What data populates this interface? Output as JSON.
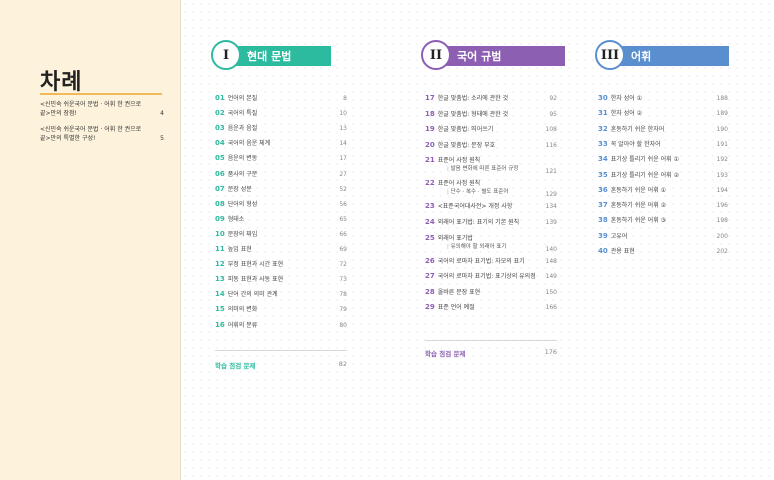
{
  "title": "차례",
  "intro": [
    {
      "text": "<신민숙 쉬운국어 문법 · 어휘 한 권으로 끝>만의 장점!",
      "page": "4"
    },
    {
      "text": "<신민숙 쉬운국어 문법 · 어휘 한 권으로 끝>만의 특별한 구성!",
      "page": "5"
    }
  ],
  "sections": [
    {
      "roman": "I",
      "title": "현대 문법",
      "color": "#2dbb9f",
      "entries": [
        {
          "num": "01",
          "title": "언어의 본질",
          "page": "8"
        },
        {
          "num": "02",
          "title": "국어의 특질",
          "page": "10"
        },
        {
          "num": "03",
          "title": "음운과 음절",
          "page": "13"
        },
        {
          "num": "04",
          "title": "국어의 음운 체계",
          "page": "14"
        },
        {
          "num": "05",
          "title": "음운의 변동",
          "page": "17"
        },
        {
          "num": "06",
          "title": "품사의 구분",
          "page": "27"
        },
        {
          "num": "07",
          "title": "문장 성분",
          "page": "52"
        },
        {
          "num": "08",
          "title": "단어의 형성",
          "page": "56"
        },
        {
          "num": "09",
          "title": "형태소",
          "page": "65"
        },
        {
          "num": "10",
          "title": "문장의 짜임",
          "page": "66"
        },
        {
          "num": "11",
          "title": "높임 표현",
          "page": "69"
        },
        {
          "num": "12",
          "title": "부정 표현과 시간 표현",
          "page": "72"
        },
        {
          "num": "13",
          "title": "피동 표현과 사동 표현",
          "page": "73"
        },
        {
          "num": "14",
          "title": "단어 간의 의미 관계",
          "page": "78"
        },
        {
          "num": "15",
          "title": "의미의 변화",
          "page": "79"
        },
        {
          "num": "16",
          "title": "어휘의 분류",
          "page": "80"
        }
      ],
      "review": {
        "label": "학습 점검 문제",
        "page": "82"
      }
    },
    {
      "roman": "II",
      "title": "국어 규범",
      "color": "#8d5fb3",
      "entries": [
        {
          "num": "17",
          "title": "한글 맞춤법: 소리에 관한 것",
          "page": "92"
        },
        {
          "num": "18",
          "title": "한글 맞춤법: 형태에 관한 것",
          "page": "95"
        },
        {
          "num": "19",
          "title": "한글 맞춤법: 띄어쓰기",
          "page": "108"
        },
        {
          "num": "20",
          "title": "한글 맞춤법: 문장 부호",
          "page": "116"
        },
        {
          "num": "21",
          "title": "표준어 사정 원칙",
          "sub": "발음 변화에 따른 표준어 규정",
          "page": "121"
        },
        {
          "num": "22",
          "title": "표준어 사정 원칙",
          "sub": "단수 · 복수 · 별도 표준어",
          "page": "129"
        },
        {
          "num": "23",
          "title": "<표준국어대사전> 개정 사항",
          "page": "134"
        },
        {
          "num": "24",
          "title": "외래어 표기법: 표기의 기본 원칙",
          "page": "139"
        },
        {
          "num": "25",
          "title": "외래어 표기법",
          "sub": "유의해야 할 외래어 표기",
          "page": "140"
        },
        {
          "num": "26",
          "title": "국어의 로마자 표기법: 자모의 표기",
          "page": "148"
        },
        {
          "num": "27",
          "title": "국어의 로마자 표기법: 표기상의 유의점",
          "page": "149"
        },
        {
          "num": "28",
          "title": "올바른 문장 표현",
          "page": "150"
        },
        {
          "num": "29",
          "title": "표준 언어 예절",
          "page": "166"
        }
      ],
      "review": {
        "label": "학습 점검 문제",
        "page": "176"
      }
    },
    {
      "roman": "III",
      "title": "어휘",
      "color": "#5a8fcf",
      "entries": [
        {
          "num": "30",
          "title": "한자 성어 ①",
          "page": "188"
        },
        {
          "num": "31",
          "title": "한자 성어 ②",
          "page": "189"
        },
        {
          "num": "32",
          "title": "혼동하기 쉬운 한자어",
          "page": "190"
        },
        {
          "num": "33",
          "title": "꼭 알아야 할 한자어",
          "page": "191"
        },
        {
          "num": "34",
          "title": "표기상 틀리기 쉬운 어휘 ①",
          "page": "192"
        },
        {
          "num": "35",
          "title": "표기상 틀리기 쉬운 어휘 ②",
          "page": "193"
        },
        {
          "num": "36",
          "title": "혼동하기 쉬운 어휘 ①",
          "page": "194"
        },
        {
          "num": "37",
          "title": "혼동하기 쉬운 어휘 ②",
          "page": "196"
        },
        {
          "num": "38",
          "title": "혼동하기 쉬운 어휘 ③",
          "page": "198"
        },
        {
          "num": "39",
          "title": "고유어",
          "page": "200"
        },
        {
          "num": "40",
          "title": "관용 표현",
          "page": "202"
        }
      ]
    }
  ]
}
